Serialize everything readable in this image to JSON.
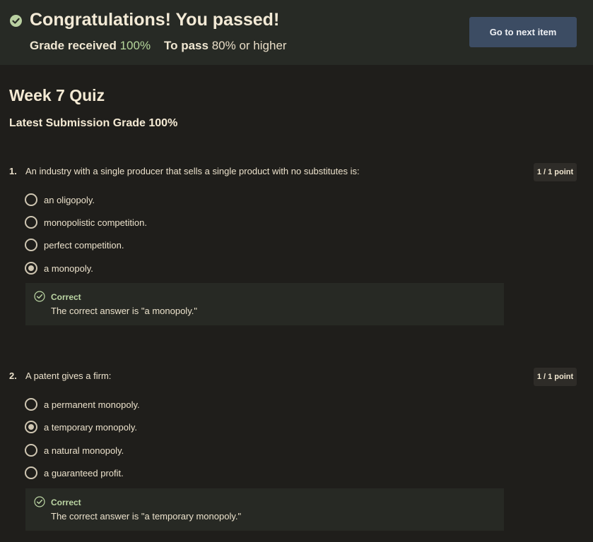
{
  "banner": {
    "title": "Congratulations! You passed!",
    "grade_label": "Grade received",
    "grade_value": "100%",
    "pass_label": "To pass",
    "pass_value": "80%",
    "pass_suffix": "or higher",
    "next_button": "Go to next item",
    "icon": "check-circle-icon",
    "accent_green": "#b5d69b",
    "button_color": "#3c4c63"
  },
  "quiz": {
    "title": "Week 7 Quiz",
    "latest_submission": "Latest Submission Grade 100%"
  },
  "questions": [
    {
      "number": "1.",
      "text": "An industry with a single producer that sells a single product with no substitutes is:",
      "points": "1 / 1 point",
      "options": [
        {
          "label": "an oligopoly.",
          "selected": false
        },
        {
          "label": "monopolistic competition.",
          "selected": false
        },
        {
          "label": "perfect competition.",
          "selected": false
        },
        {
          "label": "a monopoly.",
          "selected": true
        }
      ],
      "feedback": {
        "title": "Correct",
        "text": "The correct answer is \"a monopoly.\""
      }
    },
    {
      "number": "2.",
      "text": "A patent gives a firm:",
      "points": "1 / 1 point",
      "options": [
        {
          "label": "a permanent monopoly.",
          "selected": false
        },
        {
          "label": "a temporary monopoly.",
          "selected": true
        },
        {
          "label": "a natural monopoly.",
          "selected": false
        },
        {
          "label": "a guaranteed profit.",
          "selected": false
        }
      ],
      "feedback": {
        "title": "Correct",
        "text": "The correct answer is \"a temporary monopoly.\""
      }
    }
  ]
}
